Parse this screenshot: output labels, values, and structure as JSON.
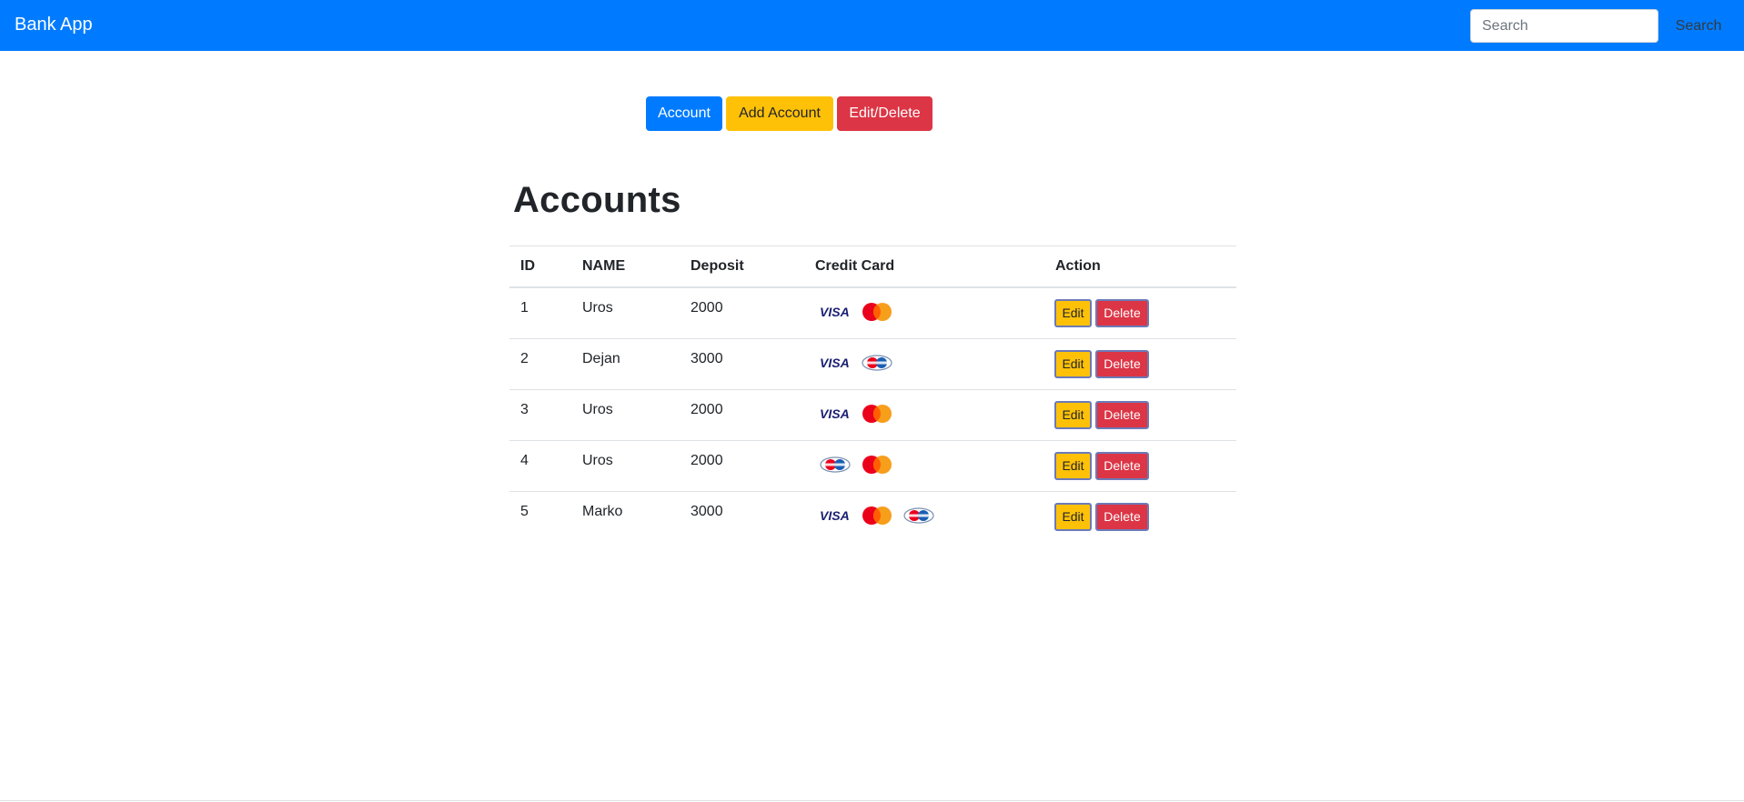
{
  "navbar": {
    "brand": "Bank App",
    "search_placeholder": "Search",
    "search_value": "",
    "search_button": "Search",
    "color": "#007bff"
  },
  "actions": {
    "account": "Account",
    "add_account": "Add Account",
    "edit_delete": "Edit/Delete"
  },
  "page": {
    "title": "Accounts"
  },
  "table": {
    "headers": [
      "ID",
      "NAME",
      "Deposit",
      "Credit Card",
      "Action"
    ],
    "rows": [
      {
        "id": "1",
        "name": "Uros",
        "deposit": "2000",
        "cards": [
          "visa-icon",
          "mastercard-icon"
        ],
        "edit": "Edit",
        "delete": "Delete"
      },
      {
        "id": "2",
        "name": "Dejan",
        "deposit": "3000",
        "cards": [
          "visa-icon",
          "dinersclub-icon"
        ],
        "edit": "Edit",
        "delete": "Delete"
      },
      {
        "id": "3",
        "name": "Uros",
        "deposit": "2000",
        "cards": [
          "visa-icon",
          "mastercard-icon"
        ],
        "edit": "Edit",
        "delete": "Delete"
      },
      {
        "id": "4",
        "name": "Uros",
        "deposit": "2000",
        "cards": [
          "dinersclub-icon",
          "mastercard-icon"
        ],
        "edit": "Edit",
        "delete": "Delete"
      },
      {
        "id": "5",
        "name": "Marko",
        "deposit": "3000",
        "cards": [
          "visa-icon",
          "mastercard-icon",
          "dinersclub-icon"
        ],
        "edit": "Edit",
        "delete": "Delete"
      }
    ]
  },
  "colors": {
    "primary": "#007bff",
    "warning": "#ffc107",
    "danger": "#dc3545"
  }
}
